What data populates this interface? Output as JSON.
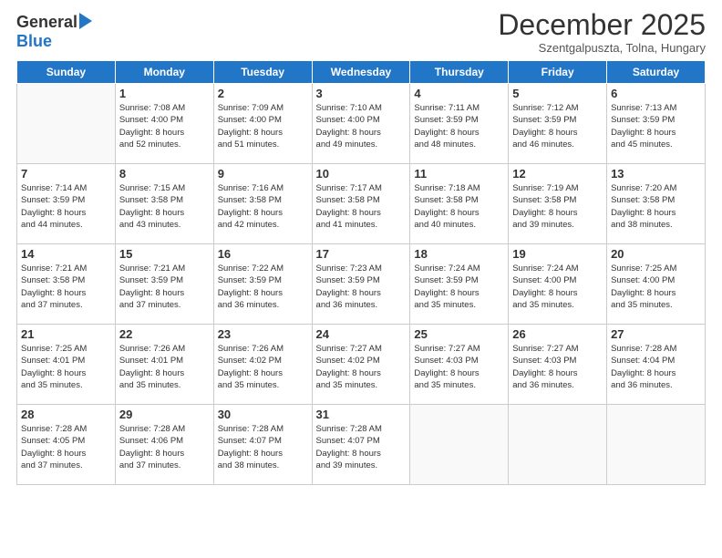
{
  "logo": {
    "line1": "General",
    "line2": "Blue"
  },
  "header": {
    "month": "December 2025",
    "location": "Szentgalpuszta, Tolna, Hungary"
  },
  "weekdays": [
    "Sunday",
    "Monday",
    "Tuesday",
    "Wednesday",
    "Thursday",
    "Friday",
    "Saturday"
  ],
  "weeks": [
    [
      {
        "day": "",
        "info": ""
      },
      {
        "day": "1",
        "info": "Sunrise: 7:08 AM\nSunset: 4:00 PM\nDaylight: 8 hours\nand 52 minutes."
      },
      {
        "day": "2",
        "info": "Sunrise: 7:09 AM\nSunset: 4:00 PM\nDaylight: 8 hours\nand 51 minutes."
      },
      {
        "day": "3",
        "info": "Sunrise: 7:10 AM\nSunset: 4:00 PM\nDaylight: 8 hours\nand 49 minutes."
      },
      {
        "day": "4",
        "info": "Sunrise: 7:11 AM\nSunset: 3:59 PM\nDaylight: 8 hours\nand 48 minutes."
      },
      {
        "day": "5",
        "info": "Sunrise: 7:12 AM\nSunset: 3:59 PM\nDaylight: 8 hours\nand 46 minutes."
      },
      {
        "day": "6",
        "info": "Sunrise: 7:13 AM\nSunset: 3:59 PM\nDaylight: 8 hours\nand 45 minutes."
      }
    ],
    [
      {
        "day": "7",
        "info": "Sunrise: 7:14 AM\nSunset: 3:59 PM\nDaylight: 8 hours\nand 44 minutes."
      },
      {
        "day": "8",
        "info": "Sunrise: 7:15 AM\nSunset: 3:58 PM\nDaylight: 8 hours\nand 43 minutes."
      },
      {
        "day": "9",
        "info": "Sunrise: 7:16 AM\nSunset: 3:58 PM\nDaylight: 8 hours\nand 42 minutes."
      },
      {
        "day": "10",
        "info": "Sunrise: 7:17 AM\nSunset: 3:58 PM\nDaylight: 8 hours\nand 41 minutes."
      },
      {
        "day": "11",
        "info": "Sunrise: 7:18 AM\nSunset: 3:58 PM\nDaylight: 8 hours\nand 40 minutes."
      },
      {
        "day": "12",
        "info": "Sunrise: 7:19 AM\nSunset: 3:58 PM\nDaylight: 8 hours\nand 39 minutes."
      },
      {
        "day": "13",
        "info": "Sunrise: 7:20 AM\nSunset: 3:58 PM\nDaylight: 8 hours\nand 38 minutes."
      }
    ],
    [
      {
        "day": "14",
        "info": "Sunrise: 7:21 AM\nSunset: 3:58 PM\nDaylight: 8 hours\nand 37 minutes."
      },
      {
        "day": "15",
        "info": "Sunrise: 7:21 AM\nSunset: 3:59 PM\nDaylight: 8 hours\nand 37 minutes."
      },
      {
        "day": "16",
        "info": "Sunrise: 7:22 AM\nSunset: 3:59 PM\nDaylight: 8 hours\nand 36 minutes."
      },
      {
        "day": "17",
        "info": "Sunrise: 7:23 AM\nSunset: 3:59 PM\nDaylight: 8 hours\nand 36 minutes."
      },
      {
        "day": "18",
        "info": "Sunrise: 7:24 AM\nSunset: 3:59 PM\nDaylight: 8 hours\nand 35 minutes."
      },
      {
        "day": "19",
        "info": "Sunrise: 7:24 AM\nSunset: 4:00 PM\nDaylight: 8 hours\nand 35 minutes."
      },
      {
        "day": "20",
        "info": "Sunrise: 7:25 AM\nSunset: 4:00 PM\nDaylight: 8 hours\nand 35 minutes."
      }
    ],
    [
      {
        "day": "21",
        "info": "Sunrise: 7:25 AM\nSunset: 4:01 PM\nDaylight: 8 hours\nand 35 minutes."
      },
      {
        "day": "22",
        "info": "Sunrise: 7:26 AM\nSunset: 4:01 PM\nDaylight: 8 hours\nand 35 minutes."
      },
      {
        "day": "23",
        "info": "Sunrise: 7:26 AM\nSunset: 4:02 PM\nDaylight: 8 hours\nand 35 minutes."
      },
      {
        "day": "24",
        "info": "Sunrise: 7:27 AM\nSunset: 4:02 PM\nDaylight: 8 hours\nand 35 minutes."
      },
      {
        "day": "25",
        "info": "Sunrise: 7:27 AM\nSunset: 4:03 PM\nDaylight: 8 hours\nand 35 minutes."
      },
      {
        "day": "26",
        "info": "Sunrise: 7:27 AM\nSunset: 4:03 PM\nDaylight: 8 hours\nand 36 minutes."
      },
      {
        "day": "27",
        "info": "Sunrise: 7:28 AM\nSunset: 4:04 PM\nDaylight: 8 hours\nand 36 minutes."
      }
    ],
    [
      {
        "day": "28",
        "info": "Sunrise: 7:28 AM\nSunset: 4:05 PM\nDaylight: 8 hours\nand 37 minutes."
      },
      {
        "day": "29",
        "info": "Sunrise: 7:28 AM\nSunset: 4:06 PM\nDaylight: 8 hours\nand 37 minutes."
      },
      {
        "day": "30",
        "info": "Sunrise: 7:28 AM\nSunset: 4:07 PM\nDaylight: 8 hours\nand 38 minutes."
      },
      {
        "day": "31",
        "info": "Sunrise: 7:28 AM\nSunset: 4:07 PM\nDaylight: 8 hours\nand 39 minutes."
      },
      {
        "day": "",
        "info": ""
      },
      {
        "day": "",
        "info": ""
      },
      {
        "day": "",
        "info": ""
      }
    ]
  ]
}
